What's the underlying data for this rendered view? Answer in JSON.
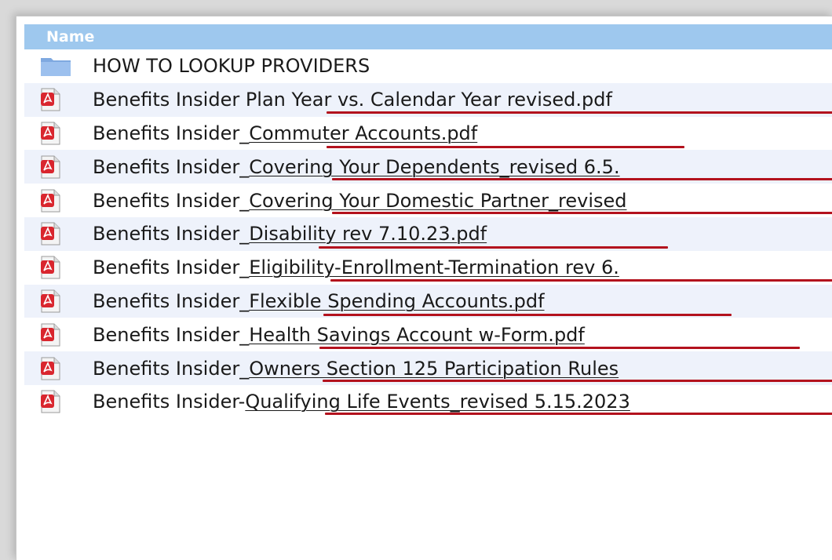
{
  "table": {
    "header_name": "Name",
    "rows": [
      {
        "type": "folder",
        "name": "HOW TO LOOKUP PROVIDERS",
        "prefix": "HOW TO LOOKUP PROVIDERS",
        "link": ""
      },
      {
        "type": "pdf",
        "name": "Benefits Insider Plan Year vs. Calendar Year revised.pdf",
        "prefix": "Benefits Insider ",
        "link": "Plan Year vs. Calendar Year revised.pdf"
      },
      {
        "type": "pdf",
        "name": "Benefits Insider_Commuter Accounts.pdf",
        "prefix": "Benefits Insider_",
        "link": "Commuter Accounts.pdf"
      },
      {
        "type": "pdf",
        "name": "Benefits Insider_Covering Your Dependents_revised 6.5.",
        "prefix": "Benefits Insider_",
        "link": "Covering Your Dependents_revised 6.5."
      },
      {
        "type": "pdf",
        "name": "Benefits Insider_Covering Your Domestic Partner_revised",
        "prefix": "Benefits Insider_",
        "link": "Covering Your Domestic Partner_revised"
      },
      {
        "type": "pdf",
        "name": "Benefits Insider_Disability rev 7.10.23.pdf",
        "prefix": "Benefits Insider_",
        "link": "Disability rev 7.10.23.pdf"
      },
      {
        "type": "pdf",
        "name": "Benefits Insider_Eligibility-Enrollment-Termination rev 6.",
        "prefix": "Benefits Insider_",
        "link": "Eligibility-Enrollment-Termination rev 6."
      },
      {
        "type": "pdf",
        "name": "Benefits Insider_Flexible Spending Accounts.pdf",
        "prefix": "Benefits Insider_",
        "link": "Flexible Spending Accounts.pdf"
      },
      {
        "type": "pdf",
        "name": "Benefits Insider_Health Savings Account w-Form.pdf",
        "prefix": "Benefits Insider_",
        "link": "Health Savings Account w-Form.pdf"
      },
      {
        "type": "pdf",
        "name": "Benefits Insider_Owners Section 125 Participation Rules",
        "prefix": "Benefits Insider_",
        "link": "Owners Section 125 Participation Rules"
      },
      {
        "type": "pdf",
        "name": "Benefits Insider-Qualifying Life Events_revised 5.15.2023",
        "prefix": "Benefits Insider-",
        "link": "Qualifying Life Events_revised 5.15.2023"
      }
    ]
  },
  "colors": {
    "header_bg": "#9ec8ee",
    "alt_row_bg": "#eef2fb",
    "annotation_red": "#b3121d",
    "pdf_red": "#d9262e"
  },
  "icons": {
    "folder": "folder-icon",
    "pdf": "pdf-file-icon"
  }
}
